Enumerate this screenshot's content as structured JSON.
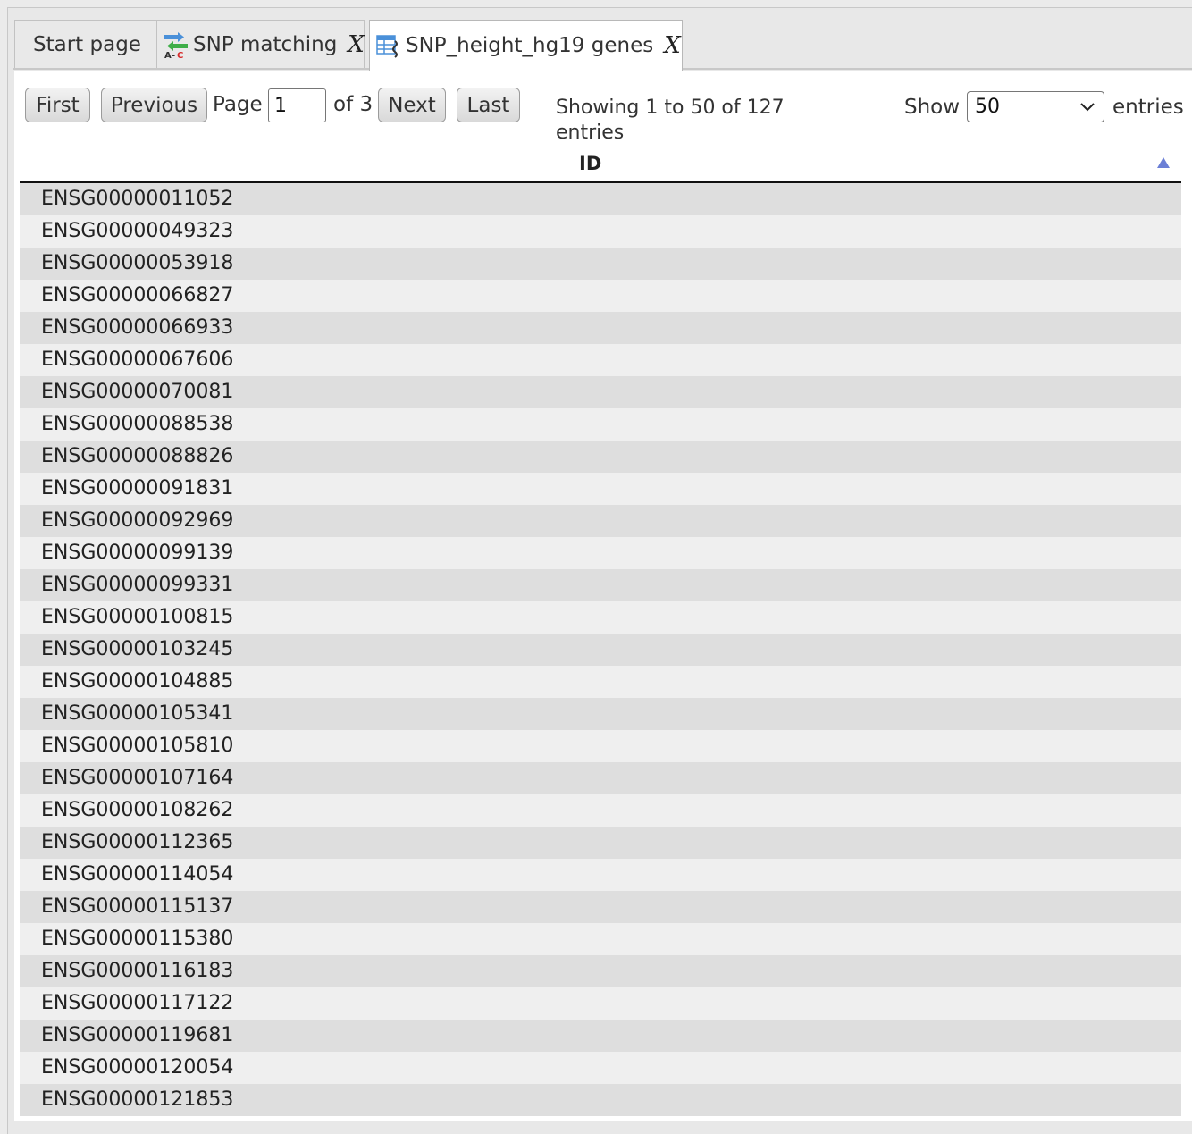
{
  "tabs": [
    {
      "label": "Start page",
      "closable": false,
      "active": false,
      "icon": null
    },
    {
      "label": "SNP matching",
      "closable": true,
      "active": false,
      "icon": "snp-matching-icon",
      "close_label": "X"
    },
    {
      "label": "SNP_height_hg19 genes",
      "closable": true,
      "active": true,
      "icon": "gene-table-icon",
      "close_label": "X"
    }
  ],
  "pager": {
    "first_label": "First",
    "previous_label": "Previous",
    "page_label": "Page",
    "page_value": "1",
    "of_label": "of 3",
    "next_label": "Next",
    "last_label": "Last"
  },
  "summary": {
    "showing_text": "Showing 1 to 50 of 127 entries"
  },
  "length_menu": {
    "show_label": "Show",
    "selected": "50",
    "entries_label": "entries"
  },
  "table": {
    "column_header": "ID",
    "sort_direction": "ascending",
    "rows": [
      "ENSG00000011052",
      "ENSG00000049323",
      "ENSG00000053918",
      "ENSG00000066827",
      "ENSG00000066933",
      "ENSG00000067606",
      "ENSG00000070081",
      "ENSG00000088538",
      "ENSG00000088826",
      "ENSG00000091831",
      "ENSG00000092969",
      "ENSG00000099139",
      "ENSG00000099331",
      "ENSG00000100815",
      "ENSG00000103245",
      "ENSG00000104885",
      "ENSG00000105341",
      "ENSG00000105810",
      "ENSG00000107164",
      "ENSG00000108262",
      "ENSG00000112365",
      "ENSG00000114054",
      "ENSG00000115137",
      "ENSG00000115380",
      "ENSG00000116183",
      "ENSG00000117122",
      "ENSG00000119681",
      "ENSG00000120054",
      "ENSG00000121853"
    ]
  },
  "colors": {
    "row_odd": "#dedede",
    "row_even": "#efefef",
    "sort_arrow": "#6b7fd6"
  }
}
